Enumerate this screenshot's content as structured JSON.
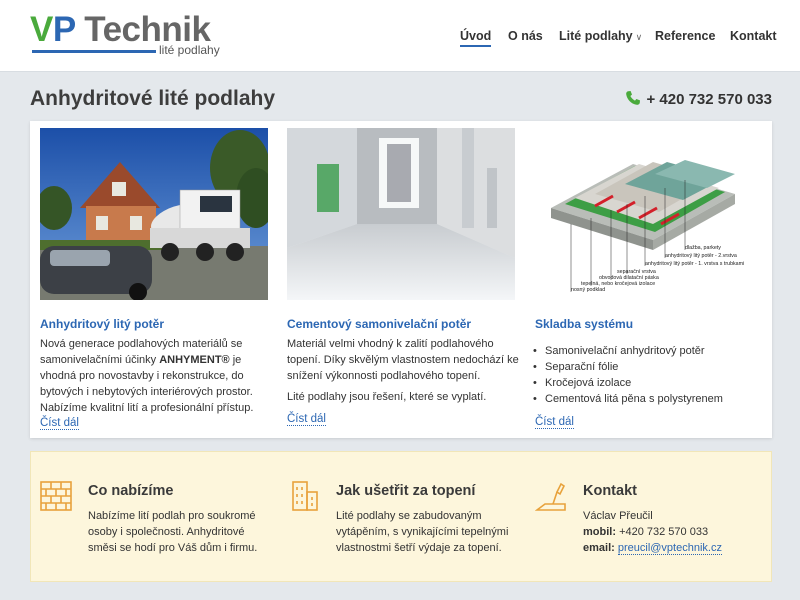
{
  "brand": {
    "logo_v": "V",
    "logo_p": "P",
    "logo_rest": " Technik",
    "tagline": "lité podlahy",
    "colors": {
      "green": "#4aaa3c",
      "blue": "#2c67b3"
    }
  },
  "nav": [
    {
      "label": "Úvod",
      "active": true
    },
    {
      "label": "O nás"
    },
    {
      "label": "Lité podlahy",
      "has_dropdown": true
    },
    {
      "label": "Reference"
    },
    {
      "label": "Kontakt"
    }
  ],
  "page_title": "Anhydritové lité podlahy",
  "phone": "+ 420 732 570 033",
  "cards": [
    {
      "title": "Anhydritový litý potěr",
      "text_before": "Nová generace podlahových materiálů se samonivelačními účinky ",
      "text_bold": "ANHYMENT®",
      "text_after": " je vhodná pro novostavby i rekonstrukce, do bytových i nebytových interiérových prostor. Nabízíme kvalitní lití a profesionální přístup.",
      "read_more": "Číst dál"
    },
    {
      "title": "Cementový samonivelační potěr",
      "text": "Materiál velmi vhodný k zalití podlahového topení. Díky skvělým vlastnostem nedochází ke snížení výkonnosti podlahového topení.",
      "text2": "Lité podlahy jsou řešení, které se vyplatí.",
      "read_more": "Číst dál"
    },
    {
      "title": "Skladba systému",
      "list": [
        "Samonivelační anhydritový potěr",
        "Separační fólie",
        "Kročejová izolace",
        "Cementová litá pěna s polystyrenem"
      ],
      "read_more": "Číst dál",
      "diagram_labels": [
        "dlažba, parkety",
        "anhydritový litý potěr - 2.vrstva",
        "anhydritový litý potěr - 1. vrstva s trubkami",
        "separační vrstva",
        "obvodová dilatační páska",
        "tepelná, nebo kročejová izolace",
        "nosný podklad"
      ]
    }
  ],
  "offer": [
    {
      "icon": "bricks-icon",
      "title": "Co nabízíme",
      "text": "Nabízíme lití podlah pro soukromé osoby i společnosti. Anhydritové směsi se hodí pro Váš dům i firmu."
    },
    {
      "icon": "building-icon",
      "title": "Jak ušetřit za topení",
      "text": "Lité podlahy se zabudovaným vytápěním, s vynikajícími tepelnými vlastnostmi šetří výdaje za topení."
    },
    {
      "icon": "trowel-icon",
      "title": "Kontakt",
      "name": "Václav Přeučil",
      "mobile_label": "mobil:",
      "mobile": "+420 732 570 033",
      "email_label": "email:",
      "email": "preucil@vptechnik.cz"
    }
  ]
}
